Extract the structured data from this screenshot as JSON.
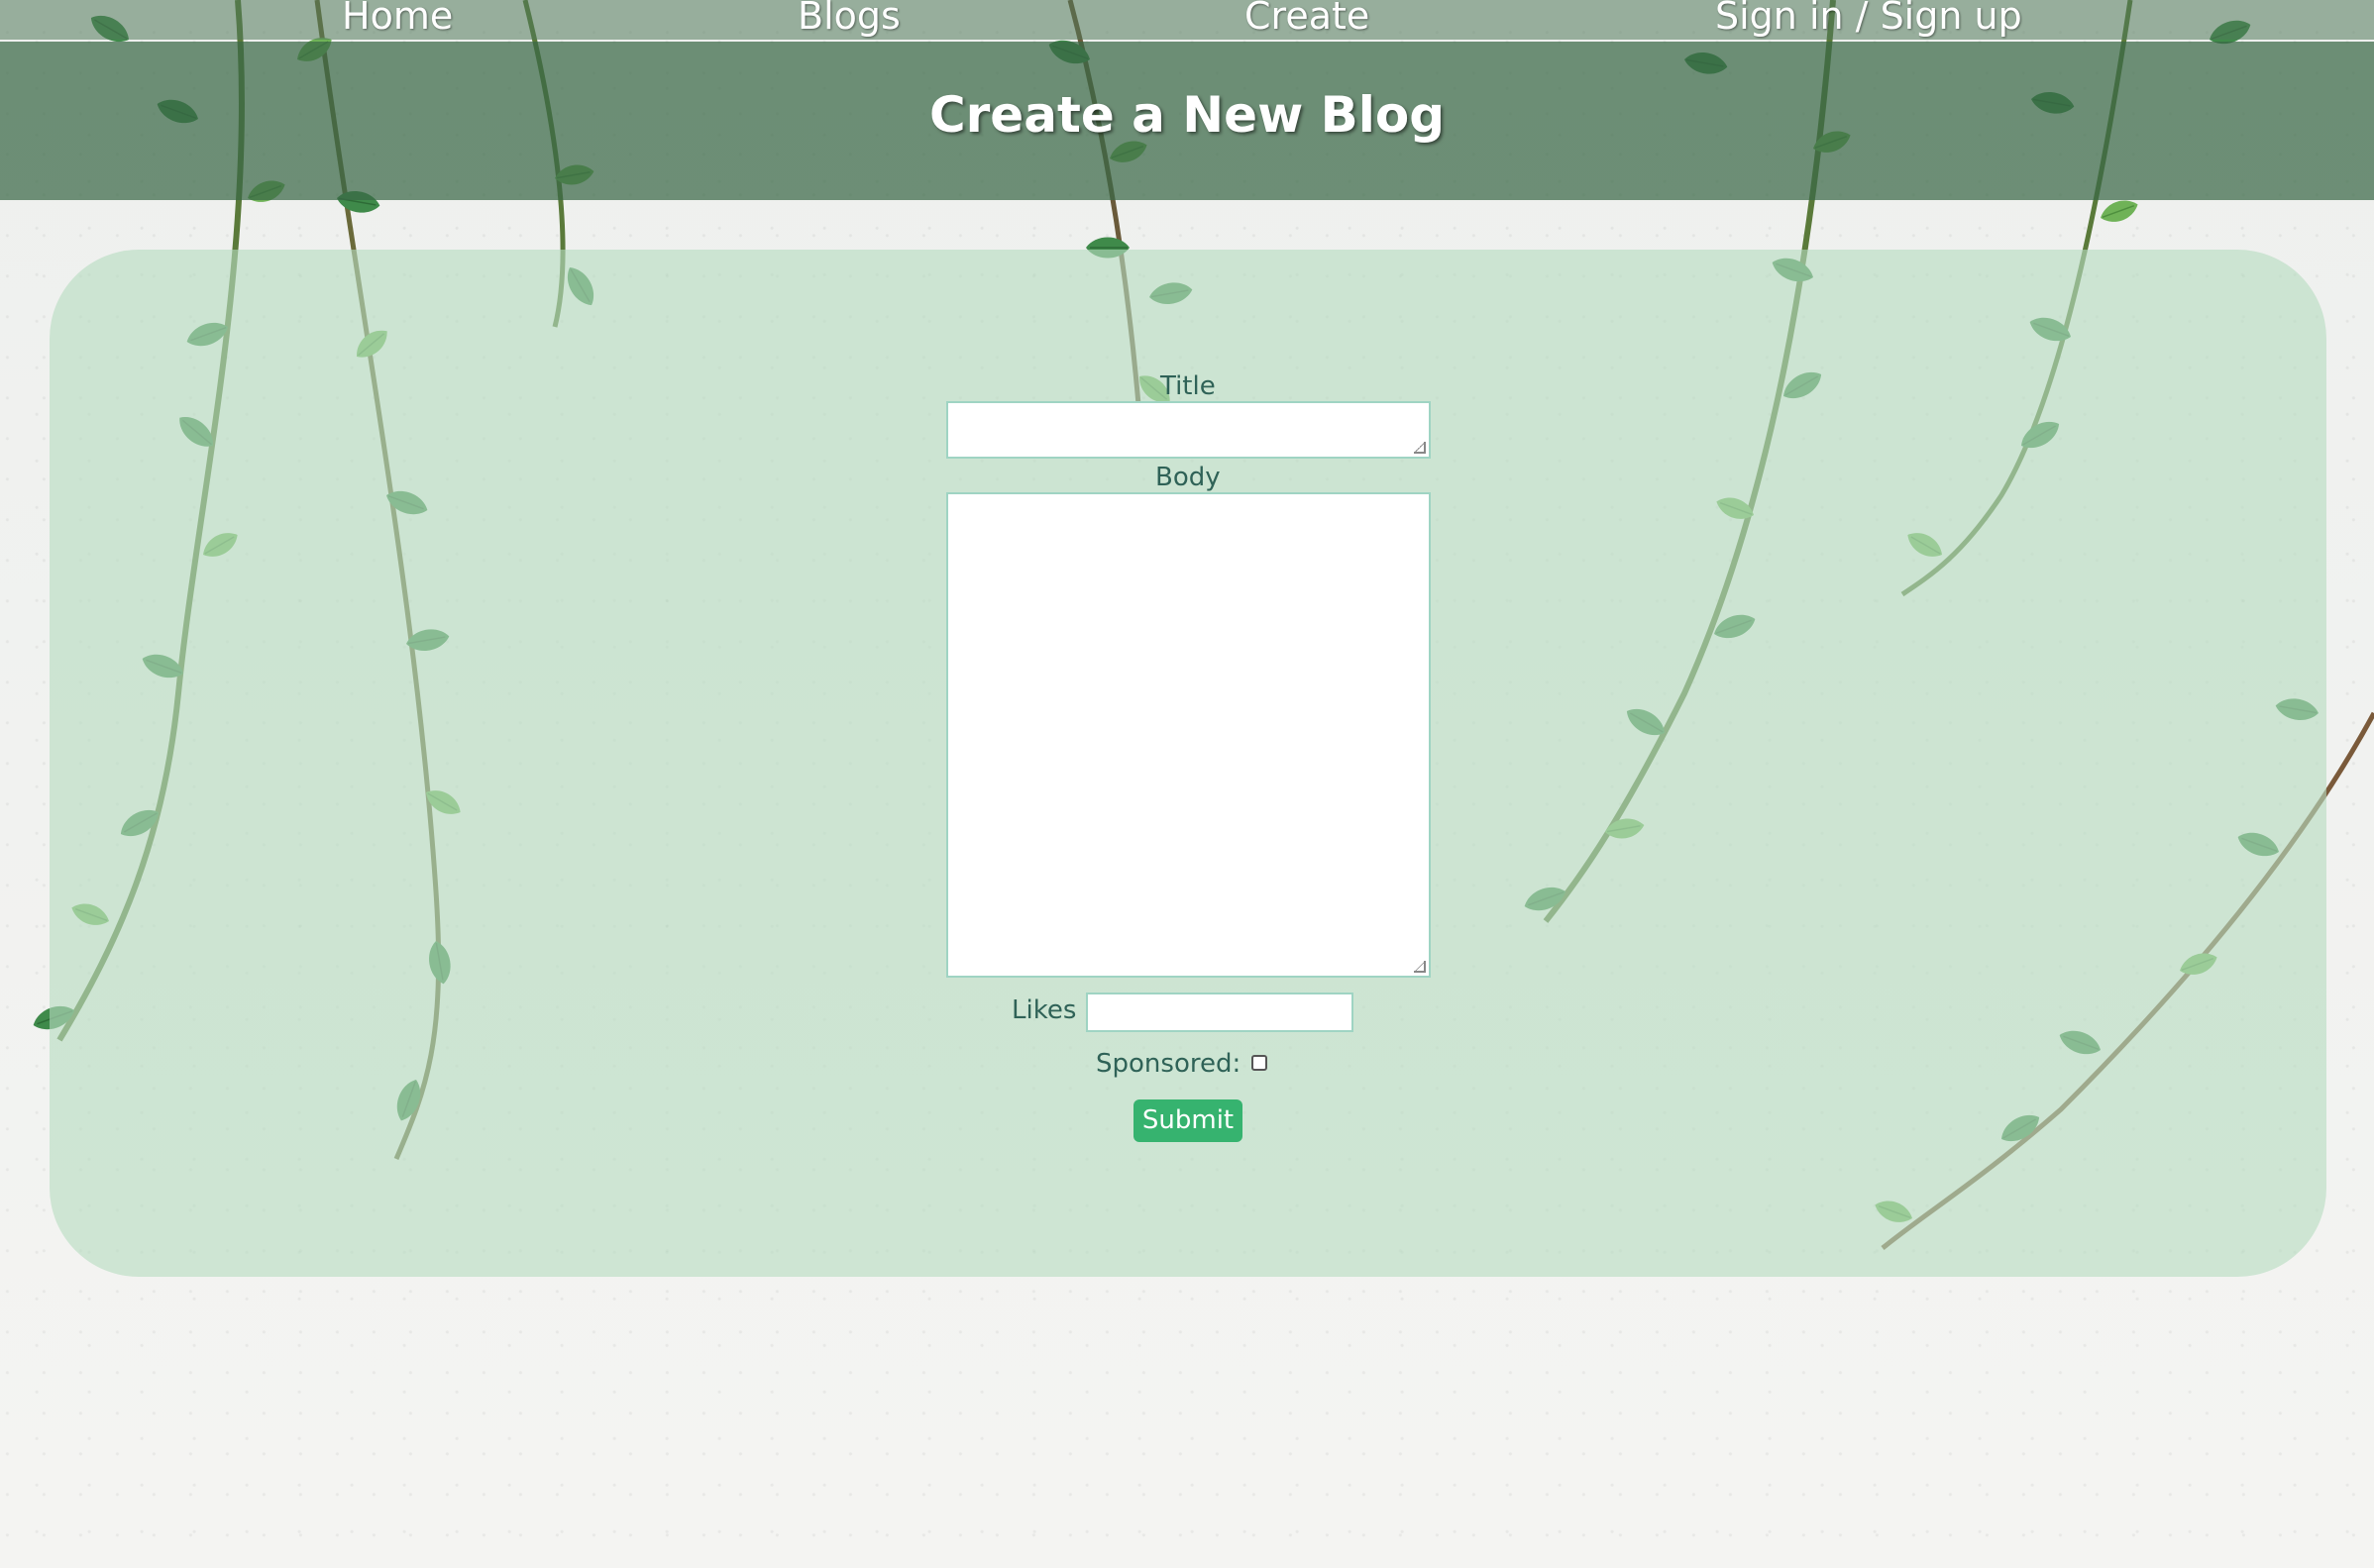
{
  "nav": {
    "items": [
      {
        "label": "Home"
      },
      {
        "label": "Blogs"
      },
      {
        "label": "Create"
      },
      {
        "label": "Sign in / Sign up"
      }
    ]
  },
  "header": {
    "title": "Create a New Blog"
  },
  "form": {
    "title_label": "Title",
    "title_value": "",
    "body_label": "Body",
    "body_value": "",
    "likes_label": "Likes",
    "likes_value": "",
    "sponsored_label": "Sponsored:",
    "sponsored_checked": false,
    "submit_label": "Submit"
  },
  "colors": {
    "nav_bg": "#50785a",
    "header_bg": "#3a6846",
    "panel_bg": "#b6dcc0",
    "label_text": "#2f6257",
    "submit_bg": "#36b36f"
  }
}
